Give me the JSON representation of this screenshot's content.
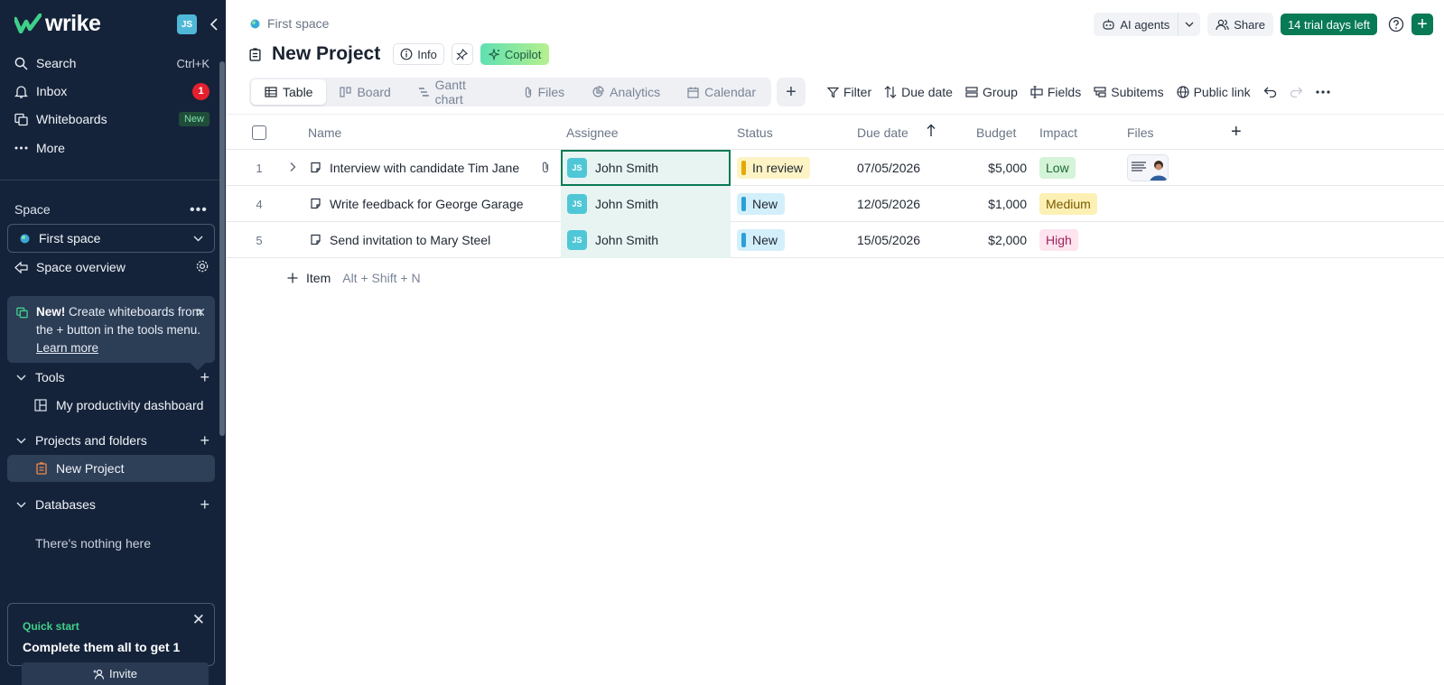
{
  "app": {
    "logo_text": "wrike",
    "user_initials": "JS"
  },
  "nav": {
    "search_label": "Search",
    "search_shortcut": "Ctrl+K",
    "inbox_label": "Inbox",
    "inbox_count": "1",
    "whiteboards_label": "Whiteboards",
    "whiteboards_badge": "New",
    "more_label": "More"
  },
  "space": {
    "label": "Space",
    "selected": "First space",
    "overview_label": "Space overview"
  },
  "tip": {
    "bold": "New!",
    "text": " Create whiteboards from the + button in the tools menu. ",
    "link": "Learn more"
  },
  "tools": {
    "label": "Tools",
    "items": [
      "My productivity dashboard"
    ]
  },
  "projects": {
    "label": "Projects and folders",
    "items": [
      "New Project"
    ]
  },
  "databases": {
    "label": "Databases",
    "empty_text": "There's nothing here"
  },
  "quick_start": {
    "label": "Quick start",
    "text": "Complete them all to get 1"
  },
  "invite_label": "Invite",
  "breadcrumb": "First space",
  "project": {
    "title": "New Project",
    "info_label": "Info",
    "copilot_label": "Copilot"
  },
  "top_actions": {
    "ai_agents": "AI agents",
    "share": "Share",
    "trial": "14 trial days left"
  },
  "views": [
    "Table",
    "Board",
    "Gantt chart",
    "Files",
    "Analytics",
    "Calendar"
  ],
  "toolbar": {
    "filter": "Filter",
    "due_date": "Due date",
    "group": "Group",
    "fields": "Fields",
    "subitems": "Subitems",
    "public_link": "Public link"
  },
  "table": {
    "columns": {
      "name": "Name",
      "assignee": "Assignee",
      "status": "Status",
      "due_date": "Due date",
      "budget": "Budget",
      "impact": "Impact",
      "files": "Files"
    },
    "rows": [
      {
        "num": "1",
        "name": "Interview with candidate Tim Jane",
        "assignee": "John Smith",
        "assignee_initials": "JS",
        "status": "In review",
        "due": "07/05/2026",
        "budget": "$5,000",
        "impact": "Low"
      },
      {
        "num": "4",
        "name": "Write feedback for George Garage",
        "assignee": "John Smith",
        "assignee_initials": "JS",
        "status": "New",
        "due": "12/05/2026",
        "budget": "$1,000",
        "impact": "Medium"
      },
      {
        "num": "5",
        "name": "Send invitation to Mary Steel",
        "assignee": "John Smith",
        "assignee_initials": "JS",
        "status": "New",
        "due": "15/05/2026",
        "budget": "$2,000",
        "impact": "High"
      }
    ],
    "add_item_label": "Item",
    "add_item_shortcut": "Alt + Shift + N"
  },
  "colors": {
    "sidebar_bg": "#15233a",
    "accent_green": "#087a55",
    "status_review": "#e6a800",
    "status_new": "#2b9fd8",
    "impact_low": "#d4f3d8",
    "impact_medium": "#fdf0b5",
    "impact_high": "#fde4ef"
  }
}
